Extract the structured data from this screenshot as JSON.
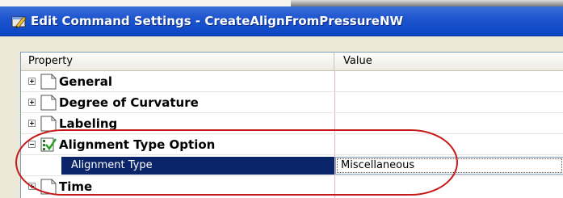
{
  "window": {
    "title": "Edit Command Settings - CreateAlignFromPressureNW"
  },
  "grid": {
    "columns": [
      "Property",
      "Value"
    ],
    "rows": [
      {
        "type": "category",
        "label": "General",
        "expanded": false
      },
      {
        "type": "category",
        "label": "Degree of Curvature",
        "expanded": false
      },
      {
        "type": "category",
        "label": "Labeling",
        "expanded": false
      },
      {
        "type": "category",
        "label": "Alignment Type Option",
        "expanded": true
      },
      {
        "type": "property",
        "label": "Alignment Type",
        "value": "Miscellaneous",
        "selected": true
      },
      {
        "type": "category",
        "label": "Time",
        "expanded": false
      }
    ]
  },
  "colors": {
    "titlebar": "#0a45c4",
    "selection": "#0a246a",
    "highlight_oval": "#c61a1a"
  }
}
